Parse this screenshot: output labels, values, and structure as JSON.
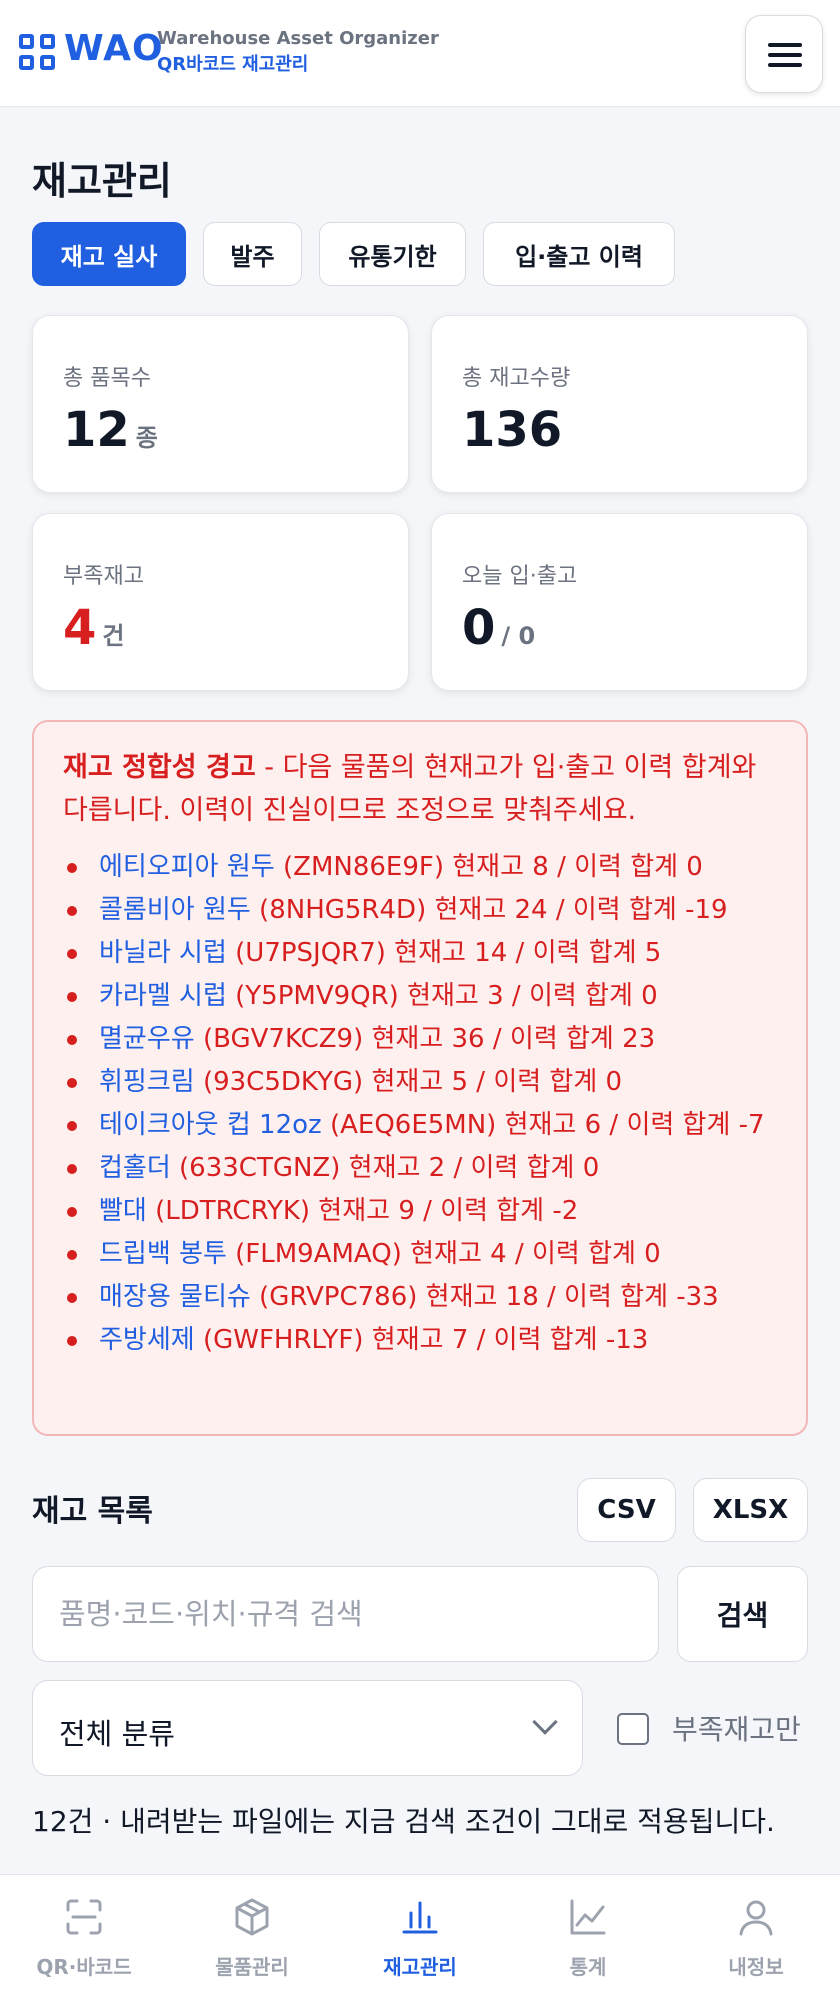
{
  "header": {
    "logo_text": "WAO",
    "subtitle_en": "Warehouse Asset Organizer",
    "subtitle_ko": "QR바코드 재고관리",
    "menu_icon": "hamburger-menu-icon"
  },
  "page": {
    "title": "재고관리"
  },
  "tabs": [
    {
      "label": "재고 실사",
      "active": true
    },
    {
      "label": "발주",
      "active": false
    },
    {
      "label": "유통기한",
      "active": false
    },
    {
      "label": "입·출고 이력",
      "active": false
    }
  ],
  "stats": {
    "total_items": {
      "label": "총 품목수",
      "value": "12",
      "unit": "종"
    },
    "total_qty": {
      "label": "총 재고수량",
      "value": "136"
    },
    "low_stock": {
      "label": "부족재고",
      "value": "4",
      "unit": "건"
    },
    "today_io": {
      "label": "오늘 입·출고",
      "value": "0",
      "suffix": "/ 0"
    }
  },
  "alert": {
    "title": "재고 정합성 경고",
    "message": " - 다음 물품의 현재고가 입·출고 이력 합계와 다릅니다. 이력이 진실이므로 조정으로 맞춰주세요.",
    "items": [
      {
        "name": "에티오피아 원두",
        "detail": " (ZMN86E9F) 현재고 8 / 이력 합계 0"
      },
      {
        "name": "콜롬비아 원두",
        "detail": " (8NHG5R4D) 현재고 24 / 이력 합계 -19"
      },
      {
        "name": "바닐라 시럽",
        "detail": " (U7PSJQR7) 현재고 14 / 이력 합계 5"
      },
      {
        "name": "카라멜 시럽",
        "detail": " (Y5PMV9QR) 현재고 3 / 이력 합계 0"
      },
      {
        "name": "멸균우유",
        "detail": " (BGV7KCZ9) 현재고 36 / 이력 합계 23"
      },
      {
        "name": "휘핑크림",
        "detail": " (93C5DKYG) 현재고 5 / 이력 합계 0"
      },
      {
        "name": "테이크아웃 컵 12oz",
        "detail": " (AEQ6E5MN) 현재고 6 / 이력 합계 -7"
      },
      {
        "name": "컵홀더",
        "detail": " (633CTGNZ) 현재고 2 / 이력 합계 0"
      },
      {
        "name": "빨대",
        "detail": " (LDTRCRYK) 현재고 9 / 이력 합계 -2"
      },
      {
        "name": "드립백 봉투",
        "detail": " (FLM9AMAQ) 현재고 4 / 이력 합계 0"
      },
      {
        "name": "매장용 물티슈",
        "detail": " (GRVPC786) 현재고 18 / 이력 합계 -33"
      },
      {
        "name": "주방세제",
        "detail": " (GWFHRLYF) 현재고 7 / 이력 합계 -13"
      }
    ]
  },
  "inventory": {
    "title": "재고 목록",
    "csv_label": "CSV",
    "xlsx_label": "XLSX",
    "search_placeholder": "품명·코드·위치·규격 검색",
    "search_value": "",
    "search_button": "검색",
    "category_selected": "전체 분류",
    "low_stock_only_label": "부족재고만",
    "low_stock_only_checked": false,
    "result_text": "12건 · 내려받는 파일에는 지금 검색 조건이 그대로 적용됩니다."
  },
  "bottom_nav": [
    {
      "label": "QR·바코드",
      "icon": "qr-scan-icon",
      "active": false
    },
    {
      "label": "물품관리",
      "icon": "box-icon",
      "active": false
    },
    {
      "label": "재고관리",
      "icon": "bar-chart-icon",
      "active": true
    },
    {
      "label": "통계",
      "icon": "line-chart-icon",
      "active": false
    },
    {
      "label": "내정보",
      "icon": "user-icon",
      "active": false
    }
  ],
  "colors": {
    "primary": "#1f5fe0",
    "danger": "#d71f1f",
    "alert_bg": "#fff0f0",
    "muted": "#6b7280"
  }
}
